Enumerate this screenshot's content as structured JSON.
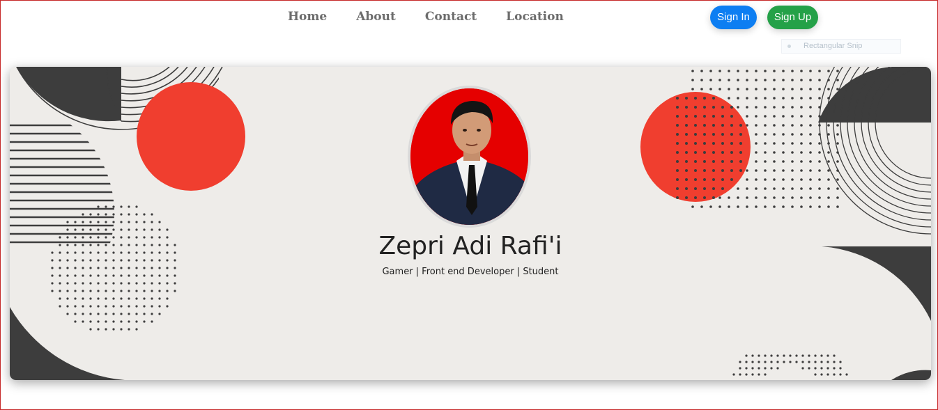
{
  "nav": {
    "items": [
      {
        "label": "Home"
      },
      {
        "label": "About"
      },
      {
        "label": "Contact"
      },
      {
        "label": "Location"
      }
    ]
  },
  "auth": {
    "sign_in_label": "Sign In",
    "sign_up_label": "Sign Up"
  },
  "snip_tooltip": {
    "label": "Rectangular Snip"
  },
  "profile": {
    "name": "Zepri Adi Rafi'i",
    "tagline": "Gamer | Front end Developer | Student"
  },
  "colors": {
    "accent_red": "#f03e2f",
    "dark_shape": "#3d3d3d",
    "banner_bg": "#eeece9",
    "sign_in": "#0d7ef2",
    "sign_up": "#24a148"
  }
}
